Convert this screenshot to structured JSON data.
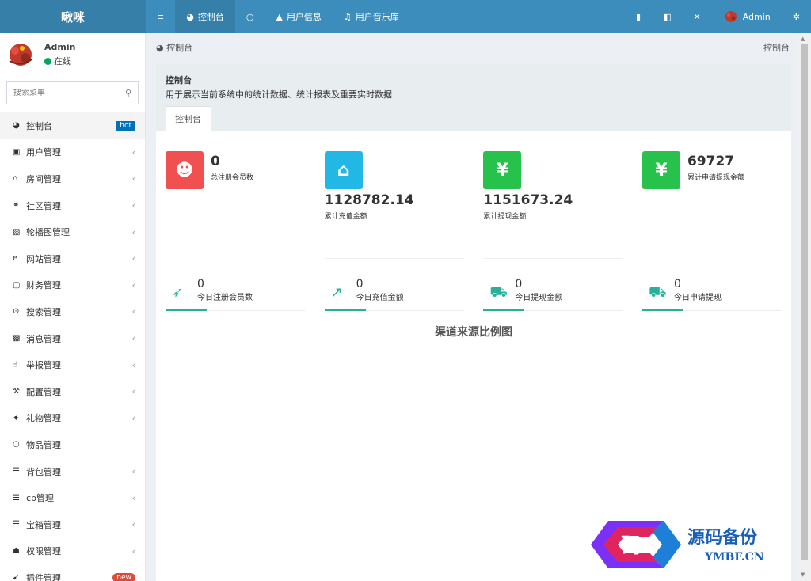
{
  "app": {
    "logo": "啾咪"
  },
  "topnav": {
    "left": [
      {
        "label": "",
        "icon": "menu-icon",
        "glyph": "≡"
      },
      {
        "label": "控制台",
        "icon": "dashboard-icon",
        "glyph": "◕"
      },
      {
        "label": "",
        "icon": "circle-icon",
        "glyph": "○"
      },
      {
        "label": "用户信息",
        "icon": "user-icon",
        "glyph": "▲"
      },
      {
        "label": "用户音乐库",
        "icon": "music-icon",
        "glyph": "♫"
      }
    ],
    "right": {
      "trash_glyph": "▮",
      "translate_glyph": "◧",
      "fullscreen_glyph": "✕",
      "user_label": "Admin",
      "settings_glyph": "✲"
    }
  },
  "sidebar": {
    "user": {
      "name": "Admin",
      "status": "在线"
    },
    "search": {
      "placeholder": "搜索菜单"
    },
    "items": [
      {
        "label": "控制台",
        "glyph": "◕",
        "badge": "hot",
        "badge_type": "hot",
        "active": true
      },
      {
        "label": "用户管理",
        "glyph": "▣",
        "chevron": "‹"
      },
      {
        "label": "房间管理",
        "glyph": "⌂",
        "chevron": "‹"
      },
      {
        "label": "社区管理",
        "glyph": "⚭",
        "chevron": "‹"
      },
      {
        "label": "轮播图管理",
        "glyph": "▨",
        "chevron": "‹"
      },
      {
        "label": "网站管理",
        "glyph": "e",
        "chevron": "‹"
      },
      {
        "label": "财务管理",
        "glyph": "▢",
        "chevron": "‹"
      },
      {
        "label": "搜索管理",
        "glyph": "⊙",
        "chevron": "‹"
      },
      {
        "label": "消息管理",
        "glyph": "▩",
        "chevron": "‹"
      },
      {
        "label": "举报管理",
        "glyph": "☝",
        "chevron": "‹"
      },
      {
        "label": "配置管理",
        "glyph": "⚒",
        "chevron": "‹"
      },
      {
        "label": "礼物管理",
        "glyph": "✦",
        "chevron": "‹"
      },
      {
        "label": "物品管理",
        "glyph": "○"
      },
      {
        "label": "背包管理",
        "glyph": "☰",
        "chevron": "‹"
      },
      {
        "label": "cp管理",
        "glyph": "☰",
        "chevron": "‹"
      },
      {
        "label": "宝箱管理",
        "glyph": "☰",
        "chevron": "‹"
      },
      {
        "label": "权限管理",
        "glyph": "☗",
        "chevron": "‹"
      },
      {
        "label": "插件管理",
        "glyph": "➹",
        "badge": "new",
        "badge_type": "new"
      }
    ]
  },
  "breadcrumb": {
    "left": "控制台",
    "right": "控制台"
  },
  "panel": {
    "title": "控制台",
    "description": "用于展示当前系统中的统计数据、统计报表及重要实时数据",
    "tab": "控制台"
  },
  "stats": [
    {
      "value": "0",
      "label": "总注册会员数",
      "color": "#f05050",
      "glyph": "☻"
    },
    {
      "value": "1128782.14",
      "label": "累计充值金额",
      "color": "#23b7e5",
      "glyph": "⌂"
    },
    {
      "value": "1151673.24",
      "label": "累计提现金额",
      "color": "#27c24c",
      "glyph": "¥"
    },
    {
      "value": "69727",
      "label": "累计申请提现金额",
      "color": "#27c24c",
      "glyph": "¥"
    }
  ],
  "today": [
    {
      "value": "0",
      "label": "今日注册会员数",
      "glyph": "➶"
    },
    {
      "value": "0",
      "label": "今日充值金额",
      "glyph": "↗"
    },
    {
      "value": "0",
      "label": "今日提现金额",
      "glyph": "⛟"
    },
    {
      "value": "0",
      "label": "今日申请提现",
      "glyph": "⛟"
    }
  ],
  "chart": {
    "title": "渠道来源比例图"
  },
  "watermark": {
    "badge": "码",
    "title": "源码备份",
    "url": "YMBF.CN"
  }
}
